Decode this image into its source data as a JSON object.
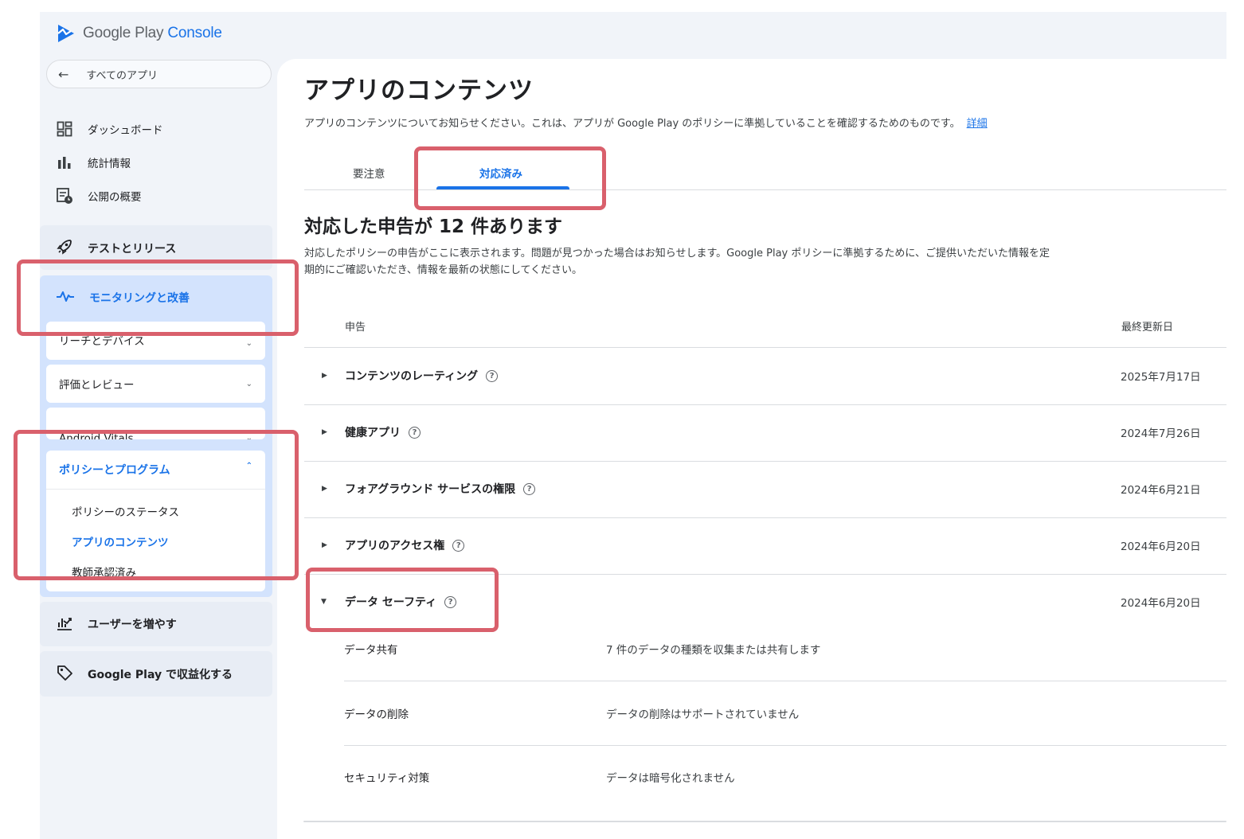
{
  "brand": {
    "google_play": "Google Play",
    "console": "Console"
  },
  "sidebar": {
    "back_label": "すべてのアプリ",
    "items": [
      {
        "label": "ダッシュボード",
        "icon": "dashboard-icon"
      },
      {
        "label": "統計情報",
        "icon": "bar-chart-icon"
      },
      {
        "label": "公開の概要",
        "icon": "publishing-overview-icon"
      }
    ],
    "sections": {
      "test_release": "テストとリリース",
      "monitoring": "モニタリングと改善",
      "grow_users": "ユーザーを増やす",
      "monetize": "Google Play で収益化する"
    },
    "monitoring_sub": {
      "reach": "リーチとデバイス",
      "ratings": "評価とレビュー",
      "vitals": "Android Vitals",
      "policy": "ポリシーとプログラム",
      "policy_items": [
        "ポリシーのステータス",
        "アプリのコンテンツ",
        "教師承認済み"
      ]
    }
  },
  "main": {
    "title": "アプリのコンテンツ",
    "subtitle": "アプリのコンテンツについてお知らせください。これは、アプリが Google Play のポリシーに準拠していることを確認するためのものです。",
    "learn_more": "詳細",
    "tabs": [
      {
        "label": "要注意"
      },
      {
        "label": "対応済み"
      }
    ],
    "section_title": "対応した申告が 12 件あります",
    "section_desc": "対応したポリシーの申告がここに表示されます。問題が見つかった場合はお知らせします。Google Play ポリシーに準拠するために、ご提供いただいた情報を定期的にご確認いただき、情報を最新の状態にしてください。",
    "table": {
      "col_declaration": "申告",
      "col_updated": "最終更新日",
      "rows": [
        {
          "name": "コンテンツのレーティング",
          "date": "2025年7月17日"
        },
        {
          "name": "健康アプリ",
          "date": "2024年7月26日"
        },
        {
          "name": "フォアグラウンド サービスの権限",
          "date": "2024年6月21日"
        },
        {
          "name": "アプリのアクセス権",
          "date": "2024年6月20日"
        },
        {
          "name": "データ セーフティ",
          "date": "2024年6月20日"
        }
      ],
      "details": [
        {
          "label": "データ共有",
          "value": "7 件のデータの種類を収集または共有します"
        },
        {
          "label": "データの削除",
          "value": "データの削除はサポートされていません"
        },
        {
          "label": "セキュリティ対策",
          "value": "データは暗号化されません"
        }
      ]
    }
  },
  "colors": {
    "accent": "#1a73e8",
    "highlight": "#d9606c",
    "sidebar_bg": "#f1f4f9",
    "active_section_bg": "#d3e3fd"
  }
}
